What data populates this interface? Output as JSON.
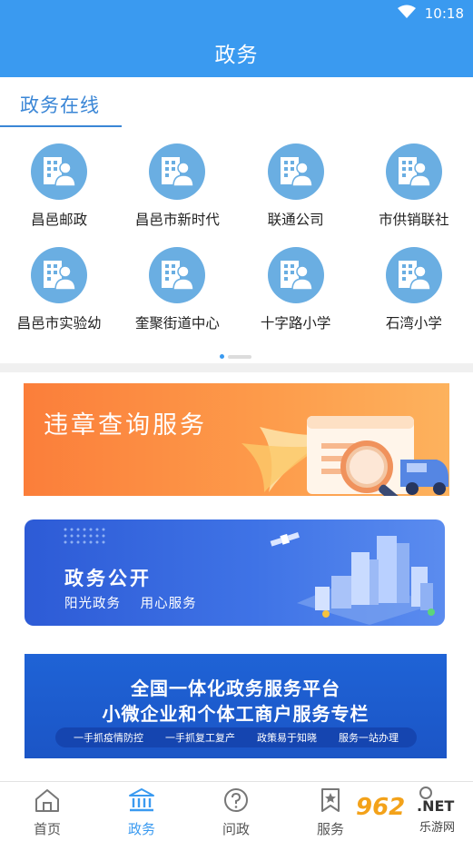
{
  "status_bar": {
    "time": "10:18",
    "wifi_icon": "wifi-icon",
    "battery_icon": "battery-icon"
  },
  "header": {
    "title": "政务"
  },
  "section": {
    "title": "政务在线"
  },
  "orgs": [
    {
      "label": "昌邑邮政",
      "icon": "building-person-icon"
    },
    {
      "label": "昌邑市新时代",
      "icon": "building-person-icon"
    },
    {
      "label": "联通公司",
      "icon": "building-person-icon"
    },
    {
      "label": "市供销联社",
      "icon": "building-person-icon"
    },
    {
      "label": "昌邑市实验幼",
      "icon": "building-person-icon"
    },
    {
      "label": "奎聚街道中心",
      "icon": "building-person-icon"
    },
    {
      "label": "十字路小学",
      "icon": "building-person-icon"
    },
    {
      "label": "石湾小学",
      "icon": "building-person-icon"
    }
  ],
  "pager": {
    "page": 1,
    "pages": 2
  },
  "banners": {
    "violation": {
      "title": "违章查询服务"
    },
    "open": {
      "title": "政务公开",
      "sub1": "阳光政务",
      "sub2": "用心服务"
    },
    "platform": {
      "line1": "全国一体化政务服务平台",
      "line2": "小微企业和个体工商户服务专栏",
      "tags": [
        "一手抓疫情防控",
        "一手抓复工复产",
        "政策易于知晓",
        "服务一站办理"
      ]
    }
  },
  "tabs": [
    {
      "label": "首页",
      "icon": "home-icon",
      "active": false
    },
    {
      "label": "政务",
      "icon": "government-building-icon",
      "active": true
    },
    {
      "label": "问政",
      "icon": "question-circle-icon",
      "active": false
    },
    {
      "label": "服务",
      "icon": "bookmark-star-icon",
      "active": false
    }
  ],
  "watermark": {
    "number": "962",
    "net": ".NET",
    "text": "乐游网"
  },
  "colors": {
    "primary": "#3a9af0",
    "avatar": "#6aaee2",
    "banner_orange": "#fb7e3a",
    "banner_blue": "#2d5bd6"
  }
}
